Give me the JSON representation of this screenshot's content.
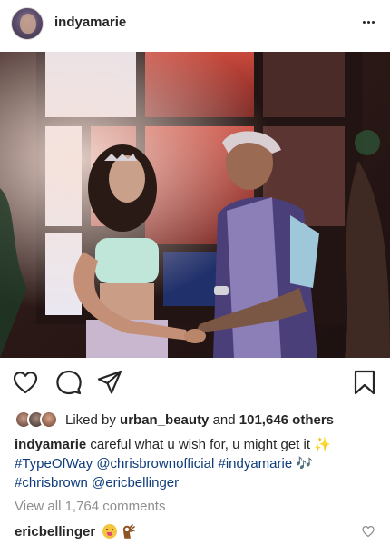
{
  "post": {
    "username": "indyamarie",
    "likes": {
      "prefix": "Liked by",
      "liker": "urban_beauty",
      "joiner": "and",
      "count": "101,646 others"
    },
    "caption": {
      "author": "indyamarie",
      "text": "careful what u wish for, u might get it",
      "sparkle": "✨",
      "hashtag1": "#TypeOfWay",
      "mention1": "@chrisbrownofficial",
      "hashtag2": "#indyamarie",
      "music": "🎶",
      "hashtag3": "#chrisbrown",
      "mention2": "@ericbellinger"
    },
    "view_all_comments": "View all 1,764 comments",
    "comments": [
      {
        "author": "ericbellinger"
      }
    ]
  },
  "icons": {
    "header": [
      "avatar",
      "more-options-icon"
    ],
    "actions": [
      "heart-icon",
      "comment-icon",
      "share-icon",
      "bookmark-icon"
    ],
    "comment": [
      "tongue-out-emoji-icon",
      "ok-hand-emoji-icon",
      "heart-icon"
    ]
  },
  "colors": {
    "text": "#262626",
    "link": "#0d3c7a",
    "muted": "#8e8e8e"
  }
}
